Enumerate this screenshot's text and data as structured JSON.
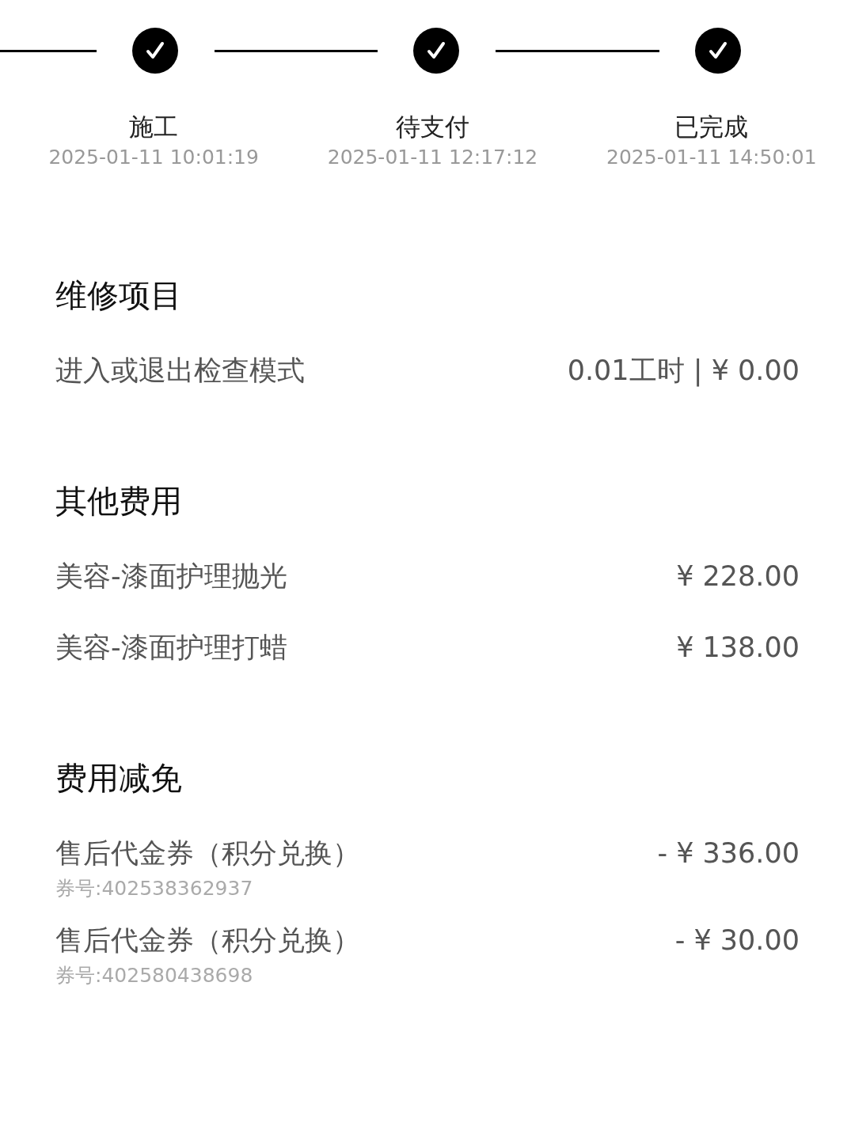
{
  "steps": [
    {
      "label": "施工",
      "time": "2025-01-11 10:01:19",
      "done": true
    },
    {
      "label": "待支付",
      "time": "2025-01-11 12:17:12",
      "done": true
    },
    {
      "label": "已完成",
      "time": "2025-01-11 14:50:01",
      "done": true
    }
  ],
  "sections": [
    {
      "title": "维修项目",
      "items": [
        {
          "name": "进入或退出检查模式",
          "amount": "0.01工时 | ¥ 0.00"
        }
      ]
    },
    {
      "title": "其他费用",
      "items": [
        {
          "name": "美容-漆面护理抛光",
          "amount": "¥ 228.00"
        },
        {
          "name": "美容-漆面护理打蜡",
          "amount": "¥ 138.00"
        }
      ]
    },
    {
      "title": "费用减免",
      "items": [
        {
          "name": "售后代金券（积分兑换）",
          "amount": "- ¥ 336.00",
          "note": "券号:402538362937"
        },
        {
          "name": "售后代金券（积分兑换）",
          "amount": "- ¥ 30.00",
          "note": "券号:402580438698"
        }
      ]
    }
  ]
}
